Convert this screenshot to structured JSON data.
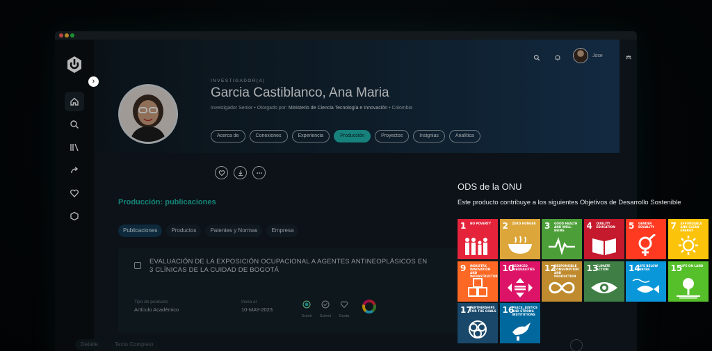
{
  "user": {
    "name": "Jose"
  },
  "profile": {
    "kicker": "INVESTIGADOR(A)",
    "name": "Garcia Castiblanco, Ana Maria",
    "role": "Investigador Senior",
    "granted_label": "• Otorgado por:",
    "granted_by": "Ministerio de Ciencia Tecnología e Innovación",
    "country": "• Colombia"
  },
  "tabs": [
    "Acerca de",
    "Conexiones",
    "Experiencia",
    "Producción",
    "Proyectos",
    "Insignias",
    "Analítica"
  ],
  "active_tab": "Producción",
  "section_title": "Producción: publicaciones",
  "pills": [
    "Publicaciones",
    "Productos",
    "Patentes y Normas",
    "Empresa"
  ],
  "publication": {
    "title": "EVALUACIÓN DE LA EXPOSICIÓN OCUPACIONAL A AGENTES ANTINEOPLÁSICOS EN 3 CLÍNICAS DE LA CUIDAD DE BOGOTÁ",
    "type_label": "Tipo de producto",
    "type_value": "Artículo Académico",
    "date_label": "Inicia el",
    "date_value": "10-MAY-2023",
    "metrics": [
      "Sciorii",
      "Scienti",
      "Gusta"
    ]
  },
  "bottom_tabs": [
    "Detalle",
    "Texto Completo"
  ],
  "ods": {
    "title": "ODS de la ONU",
    "description": "Este producto contribuye a los siguientes Objetivos de Desarrollo Sostenible",
    "goals": [
      {
        "num": "1",
        "title": "No poverty",
        "color": "#e5243b",
        "icon": "family-icon"
      },
      {
        "num": "2",
        "title": "Zero hunger",
        "color": "#dda63a",
        "icon": "bowl-icon"
      },
      {
        "num": "3",
        "title": "Good health and well-being",
        "color": "#4c9f38",
        "icon": "heartbeat-icon"
      },
      {
        "num": "4",
        "title": "Quality education",
        "color": "#c5192d",
        "icon": "book-icon"
      },
      {
        "num": "5",
        "title": "Gender equality",
        "color": "#ff3a21",
        "icon": "gender-icon"
      },
      {
        "num": "7",
        "title": "Affordable and clean energy",
        "color": "#fcc30b",
        "icon": "sun-icon"
      },
      {
        "num": "9",
        "title": "Industry, innovation and infrastructure",
        "color": "#fd6925",
        "icon": "cubes-icon"
      },
      {
        "num": "10",
        "title": "Reduced inequalities",
        "color": "#dd1367",
        "icon": "arrows-icon"
      },
      {
        "num": "12",
        "title": "Responsible consumption and production",
        "color": "#bf8b2e",
        "icon": "infinity-icon"
      },
      {
        "num": "13",
        "title": "Climate action",
        "color": "#3f7e44",
        "icon": "eye-icon"
      },
      {
        "num": "14",
        "title": "Life below water",
        "color": "#0a97d9",
        "icon": "fish-icon"
      },
      {
        "num": "15",
        "title": "Life on land",
        "color": "#56c02b",
        "icon": "tree-icon"
      },
      {
        "num": "17",
        "title": "Partnerships for the goals",
        "color": "#19486a",
        "icon": "rings-icon"
      },
      {
        "num": "16",
        "title": "Peace, justice and strong institutions",
        "color": "#00689d",
        "icon": "dove-icon"
      }
    ]
  }
}
